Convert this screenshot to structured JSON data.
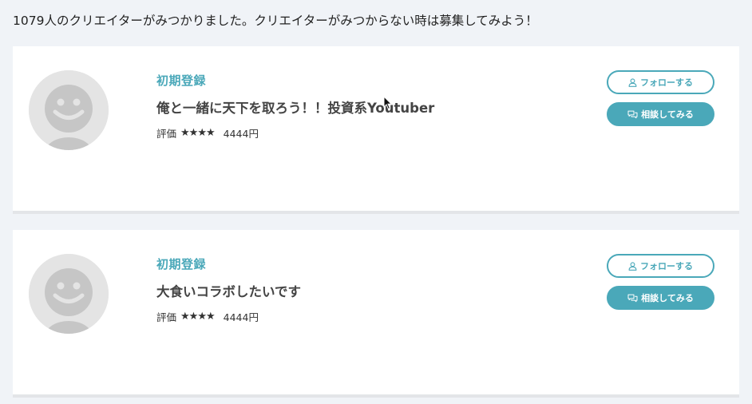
{
  "summary_text": "1079人のクリエイターがみつかりました。クリエイターがみつからない時は募集してみよう！",
  "colors": {
    "accent": "#4aa8b9",
    "background": "#f0f3f7",
    "card": "#ffffff",
    "avatar_placeholder": "#e4e4e4"
  },
  "creators": [
    {
      "avatar_icon": "default-user-avatar-icon",
      "status": "初期登録",
      "title": "俺と一緒に天下を取ろう！！投資系Youtuber",
      "rating_label": "評価",
      "stars": "★★★★",
      "price": "4444円",
      "follow_label": "フォローする",
      "follow_icon": "user-icon",
      "consult_label": "相談してみる",
      "consult_icon": "chat-bubbles-icon"
    },
    {
      "avatar_icon": "default-user-avatar-icon",
      "status": "初期登録",
      "title": "大食いコラボしたいです",
      "rating_label": "評価",
      "stars": "★★★★",
      "price": "4444円",
      "follow_label": "フォローする",
      "follow_icon": "user-icon",
      "consult_label": "相談してみる",
      "consult_icon": "chat-bubbles-icon"
    }
  ]
}
